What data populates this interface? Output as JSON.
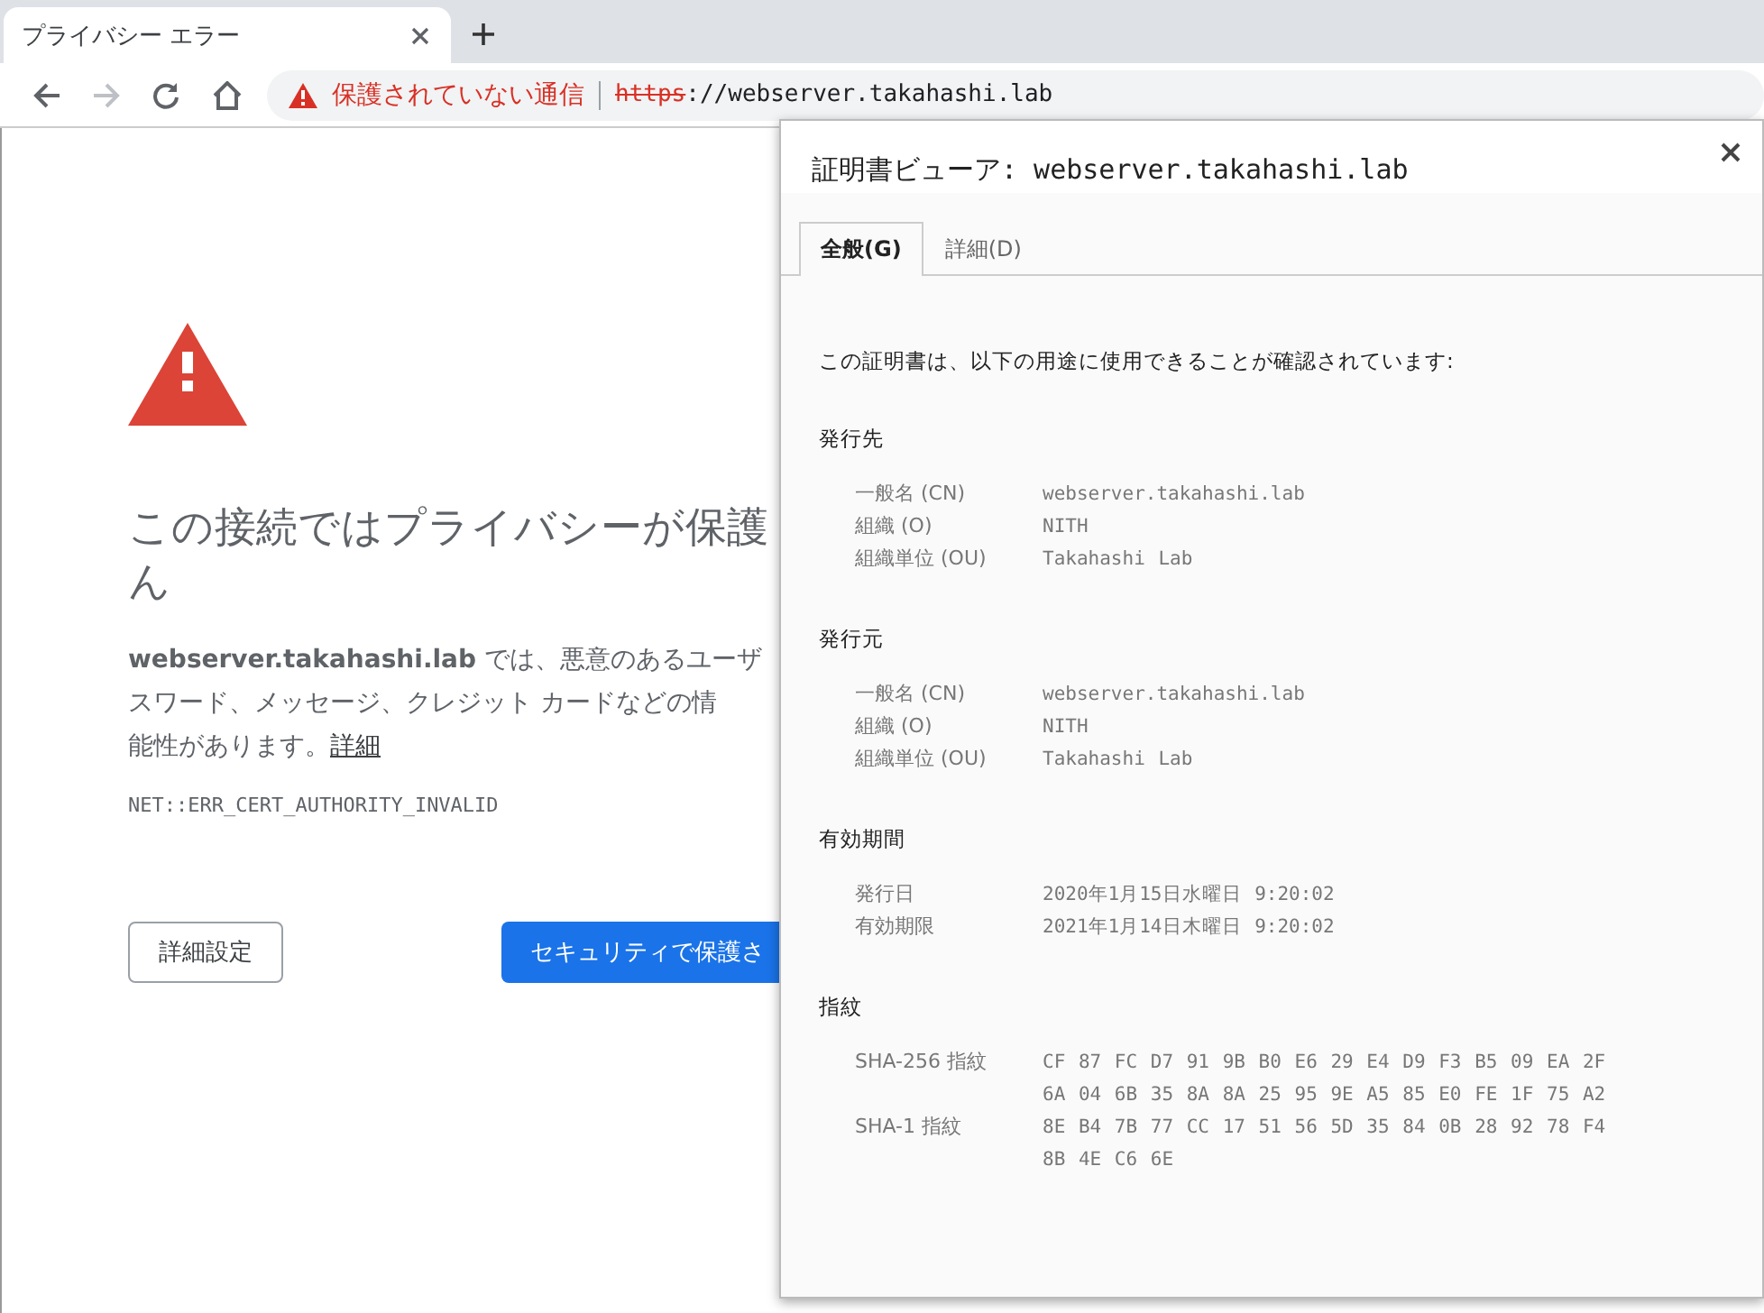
{
  "browser": {
    "tab": {
      "title": "プライバシー エラー",
      "selected": true
    },
    "address": {
      "warning": "保護されていない通信",
      "scheme": "https",
      "rest": "://webserver.takahashi.lab"
    }
  },
  "page": {
    "heading_lines": [
      "この接続ではプライバシーが保護",
      "ん"
    ],
    "paragraph_lines": [
      "**webserver.takahashi.lab** では、悪意のあるユーザ",
      "スワード、メッセージ、クレジット カードなどの情"
    ],
    "last_line": {
      "text": "能性があります。",
      "link": "詳細"
    },
    "error_code": "NET::ERR_CERT_AUTHORITY_INVALID",
    "buttons": [
      {
        "label": "詳細設定",
        "kind": "secondary"
      },
      {
        "label": "セキュリティで保護さ",
        "kind": "primary"
      }
    ]
  },
  "dialog": {
    "title": "証明書ビューア: webserver.takahashi.lab",
    "tabs": [
      {
        "label": "全般(G)",
        "selected": true
      },
      {
        "label": "詳細(D)",
        "selected": false
      }
    ],
    "intro": "この証明書は、以下の用途に使用できることが確認されています:",
    "sections": [
      {
        "heading": "発行先",
        "rows": [
          {
            "label": "一般名 (CN)",
            "value_lines": [
              "webserver.takahashi.lab"
            ]
          },
          {
            "label": "組織 (O)",
            "value_lines": [
              "NITH"
            ]
          },
          {
            "label": "組織単位 (OU)",
            "value_lines": [
              "Takahashi Lab"
            ]
          }
        ]
      },
      {
        "heading": "発行元",
        "rows": [
          {
            "label": "一般名 (CN)",
            "value_lines": [
              "webserver.takahashi.lab"
            ]
          },
          {
            "label": "組織 (O)",
            "value_lines": [
              "NITH"
            ]
          },
          {
            "label": "組織単位 (OU)",
            "value_lines": [
              "Takahashi Lab"
            ]
          }
        ]
      },
      {
        "heading": "有効期間",
        "rows": [
          {
            "label": "発行日",
            "value_lines": [
              "2020年1月15日水曜日 9:20:02"
            ]
          },
          {
            "label": "有効期限",
            "value_lines": [
              "2021年1月14日木曜日 9:20:02"
            ]
          }
        ]
      },
      {
        "heading": "指紋",
        "rows": [
          {
            "label": "SHA-256 指紋",
            "value_lines": [
              "CF 87 FC D7 91 9B B0 E6 29 E4 D9 F3 B5 09 EA 2F",
              "6A 04 6B 35 8A 8A 25 95 9E A5 85 E0 FE 1F 75 A2"
            ]
          },
          {
            "label": "SHA-1 指紋",
            "value_lines": [
              "8E B4 7B 77 CC 17 51 56 5D 35 84 0B 28 92 78 F4",
              "8B 4E C6 6E"
            ]
          }
        ]
      }
    ]
  }
}
